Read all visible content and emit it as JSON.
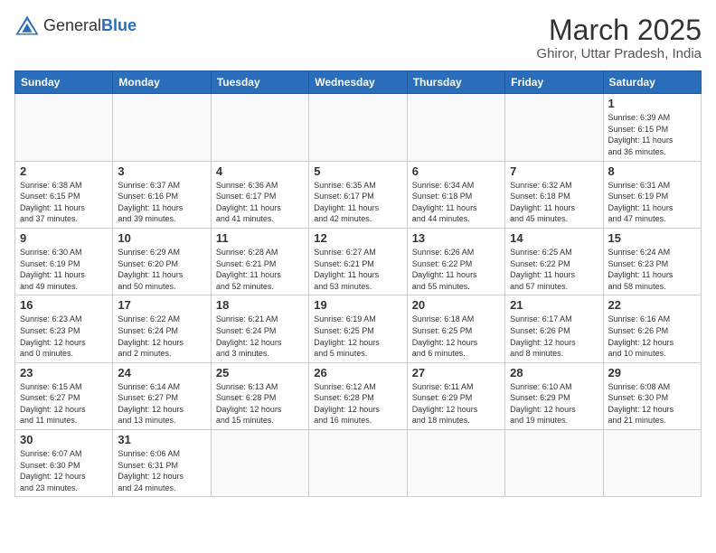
{
  "header": {
    "logo_general": "General",
    "logo_blue": "Blue",
    "title": "March 2025",
    "subtitle": "Ghiror, Uttar Pradesh, India"
  },
  "weekdays": [
    "Sunday",
    "Monday",
    "Tuesday",
    "Wednesday",
    "Thursday",
    "Friday",
    "Saturday"
  ],
  "rows": [
    [
      {
        "day": "",
        "info": ""
      },
      {
        "day": "",
        "info": ""
      },
      {
        "day": "",
        "info": ""
      },
      {
        "day": "",
        "info": ""
      },
      {
        "day": "",
        "info": ""
      },
      {
        "day": "",
        "info": ""
      },
      {
        "day": "1",
        "info": "Sunrise: 6:39 AM\nSunset: 6:15 PM\nDaylight: 11 hours\nand 36 minutes."
      }
    ],
    [
      {
        "day": "2",
        "info": "Sunrise: 6:38 AM\nSunset: 6:15 PM\nDaylight: 11 hours\nand 37 minutes."
      },
      {
        "day": "3",
        "info": "Sunrise: 6:37 AM\nSunset: 6:16 PM\nDaylight: 11 hours\nand 39 minutes."
      },
      {
        "day": "4",
        "info": "Sunrise: 6:36 AM\nSunset: 6:17 PM\nDaylight: 11 hours\nand 41 minutes."
      },
      {
        "day": "5",
        "info": "Sunrise: 6:35 AM\nSunset: 6:17 PM\nDaylight: 11 hours\nand 42 minutes."
      },
      {
        "day": "6",
        "info": "Sunrise: 6:34 AM\nSunset: 6:18 PM\nDaylight: 11 hours\nand 44 minutes."
      },
      {
        "day": "7",
        "info": "Sunrise: 6:32 AM\nSunset: 6:18 PM\nDaylight: 11 hours\nand 45 minutes."
      },
      {
        "day": "8",
        "info": "Sunrise: 6:31 AM\nSunset: 6:19 PM\nDaylight: 11 hours\nand 47 minutes."
      }
    ],
    [
      {
        "day": "9",
        "info": "Sunrise: 6:30 AM\nSunset: 6:19 PM\nDaylight: 11 hours\nand 49 minutes."
      },
      {
        "day": "10",
        "info": "Sunrise: 6:29 AM\nSunset: 6:20 PM\nDaylight: 11 hours\nand 50 minutes."
      },
      {
        "day": "11",
        "info": "Sunrise: 6:28 AM\nSunset: 6:21 PM\nDaylight: 11 hours\nand 52 minutes."
      },
      {
        "day": "12",
        "info": "Sunrise: 6:27 AM\nSunset: 6:21 PM\nDaylight: 11 hours\nand 53 minutes."
      },
      {
        "day": "13",
        "info": "Sunrise: 6:26 AM\nSunset: 6:22 PM\nDaylight: 11 hours\nand 55 minutes."
      },
      {
        "day": "14",
        "info": "Sunrise: 6:25 AM\nSunset: 6:22 PM\nDaylight: 11 hours\nand 57 minutes."
      },
      {
        "day": "15",
        "info": "Sunrise: 6:24 AM\nSunset: 6:23 PM\nDaylight: 11 hours\nand 58 minutes."
      }
    ],
    [
      {
        "day": "16",
        "info": "Sunrise: 6:23 AM\nSunset: 6:23 PM\nDaylight: 12 hours\nand 0 minutes."
      },
      {
        "day": "17",
        "info": "Sunrise: 6:22 AM\nSunset: 6:24 PM\nDaylight: 12 hours\nand 2 minutes."
      },
      {
        "day": "18",
        "info": "Sunrise: 6:21 AM\nSunset: 6:24 PM\nDaylight: 12 hours\nand 3 minutes."
      },
      {
        "day": "19",
        "info": "Sunrise: 6:19 AM\nSunset: 6:25 PM\nDaylight: 12 hours\nand 5 minutes."
      },
      {
        "day": "20",
        "info": "Sunrise: 6:18 AM\nSunset: 6:25 PM\nDaylight: 12 hours\nand 6 minutes."
      },
      {
        "day": "21",
        "info": "Sunrise: 6:17 AM\nSunset: 6:26 PM\nDaylight: 12 hours\nand 8 minutes."
      },
      {
        "day": "22",
        "info": "Sunrise: 6:16 AM\nSunset: 6:26 PM\nDaylight: 12 hours\nand 10 minutes."
      }
    ],
    [
      {
        "day": "23",
        "info": "Sunrise: 6:15 AM\nSunset: 6:27 PM\nDaylight: 12 hours\nand 11 minutes."
      },
      {
        "day": "24",
        "info": "Sunrise: 6:14 AM\nSunset: 6:27 PM\nDaylight: 12 hours\nand 13 minutes."
      },
      {
        "day": "25",
        "info": "Sunrise: 6:13 AM\nSunset: 6:28 PM\nDaylight: 12 hours\nand 15 minutes."
      },
      {
        "day": "26",
        "info": "Sunrise: 6:12 AM\nSunset: 6:28 PM\nDaylight: 12 hours\nand 16 minutes."
      },
      {
        "day": "27",
        "info": "Sunrise: 6:11 AM\nSunset: 6:29 PM\nDaylight: 12 hours\nand 18 minutes."
      },
      {
        "day": "28",
        "info": "Sunrise: 6:10 AM\nSunset: 6:29 PM\nDaylight: 12 hours\nand 19 minutes."
      },
      {
        "day": "29",
        "info": "Sunrise: 6:08 AM\nSunset: 6:30 PM\nDaylight: 12 hours\nand 21 minutes."
      }
    ],
    [
      {
        "day": "30",
        "info": "Sunrise: 6:07 AM\nSunset: 6:30 PM\nDaylight: 12 hours\nand 23 minutes."
      },
      {
        "day": "31",
        "info": "Sunrise: 6:06 AM\nSunset: 6:31 PM\nDaylight: 12 hours\nand 24 minutes."
      },
      {
        "day": "",
        "info": ""
      },
      {
        "day": "",
        "info": ""
      },
      {
        "day": "",
        "info": ""
      },
      {
        "day": "",
        "info": ""
      },
      {
        "day": "",
        "info": ""
      }
    ]
  ]
}
